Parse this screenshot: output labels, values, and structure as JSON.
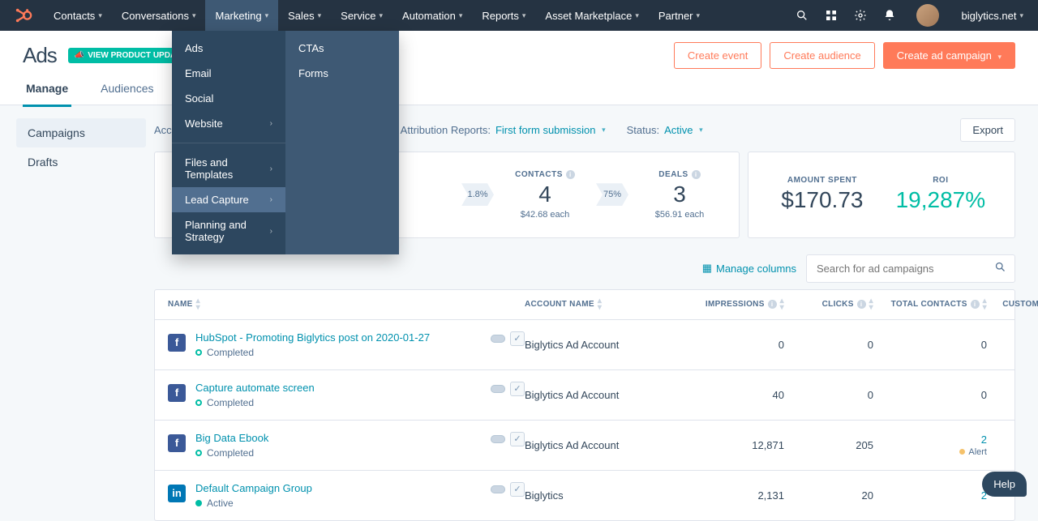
{
  "nav": {
    "items": [
      "Contacts",
      "Conversations",
      "Marketing",
      "Sales",
      "Service",
      "Automation",
      "Reports",
      "Asset Marketplace",
      "Partner"
    ],
    "active_index": 2,
    "account_label": "biglytics.net"
  },
  "menu": {
    "left": [
      {
        "label": "Ads",
        "caret": false
      },
      {
        "label": "Email",
        "caret": false
      },
      {
        "label": "Social",
        "caret": false
      },
      {
        "label": "Website",
        "caret": true
      },
      {
        "sep": true
      },
      {
        "label": "Files and Templates",
        "caret": true
      },
      {
        "label": "Lead Capture",
        "caret": true,
        "hover": true
      },
      {
        "label": "Planning and Strategy",
        "caret": true
      }
    ],
    "right": [
      "CTAs",
      "Forms"
    ]
  },
  "page": {
    "title": "Ads",
    "badge": "VIEW PRODUCT UPDATES",
    "buttons": {
      "create_event": "Create event",
      "create_audience": "Create audience",
      "create_campaign": "Create ad campaign"
    },
    "tabs": [
      "Manage",
      "Audiences"
    ],
    "active_tab": 0
  },
  "sidebar": {
    "items": [
      "Campaigns",
      "Drafts"
    ],
    "active_index": 0
  },
  "filters": {
    "accounts_label": "Acc",
    "attribution_label": "Attribution Reports:",
    "attribution_value": "First form submission",
    "status_label": "Status:",
    "status_value": "Active",
    "export": "Export"
  },
  "metrics": {
    "conv1": "1.8%",
    "contacts_label": "CONTACTS",
    "contacts_value": "4",
    "contacts_each": "$42.68 each",
    "conv2": "75%",
    "deals_label": "DEALS",
    "deals_value": "3",
    "deals_each": "$56.91 each",
    "spent_label": "AMOUNT SPENT",
    "spent_value": "$170.73",
    "roi_label": "ROI",
    "roi_value": "19,287%"
  },
  "table": {
    "manage_columns": "Manage columns",
    "search_placeholder": "Search for ad campaigns",
    "columns": [
      "NAME",
      "ACCOUNT NAME",
      "IMPRESSIONS",
      "CLICKS",
      "TOTAL CONTACTS",
      "CUSTOMERS"
    ],
    "rows": [
      {
        "network": "fb",
        "name": "HubSpot - Promoting Biglytics post on 2020-01-27",
        "status": "Completed",
        "status_style": "outline",
        "account": "Biglytics Ad Account",
        "impressions": "0",
        "clicks": "0",
        "contacts": "0",
        "customers": "",
        "checked": true
      },
      {
        "network": "fb",
        "name": "Capture automate screen",
        "status": "Completed",
        "status_style": "outline",
        "account": "Biglytics Ad Account",
        "impressions": "40",
        "clicks": "0",
        "contacts": "0",
        "customers": "",
        "checked": true
      },
      {
        "network": "fb",
        "name": "Big Data Ebook",
        "status": "Completed",
        "status_style": "outline",
        "account": "Biglytics Ad Account",
        "impressions": "12,871",
        "clicks": "205",
        "contacts": "2",
        "contacts_link": true,
        "alert": "Alert",
        "checked": true
      },
      {
        "network": "li",
        "name": "Default Campaign Group",
        "status": "Active",
        "status_style": "solid",
        "account": "Biglytics",
        "impressions": "2,131",
        "clicks": "20",
        "contacts": "2",
        "contacts_link": true,
        "checked": true
      }
    ]
  },
  "help": "Help"
}
